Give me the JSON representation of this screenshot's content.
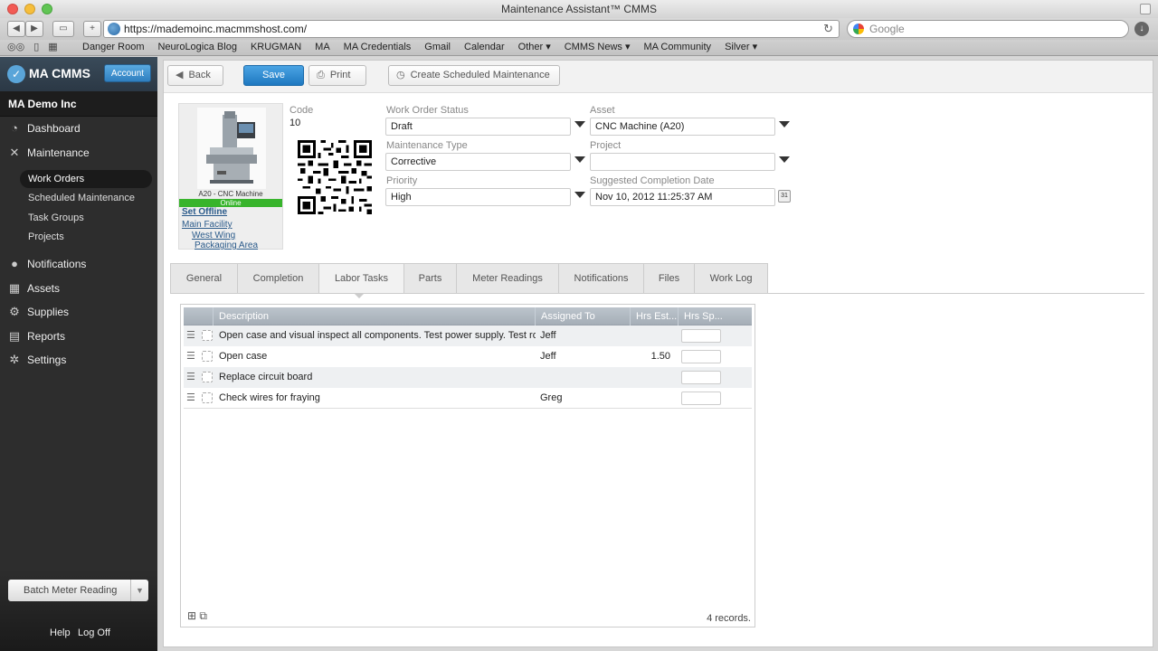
{
  "window": {
    "title": "Maintenance Assistant™ CMMS"
  },
  "browser": {
    "url": "https://mademoinc.macmmshost.com/",
    "search_placeholder": "Google",
    "bookmarks": [
      "Danger Room",
      "NeuroLogica Blog",
      "KRUGMAN",
      "MA",
      "MA Credentials",
      "Gmail",
      "Calendar",
      "Other ▾",
      "CMMS News ▾",
      "MA Community",
      "Silver ▾"
    ]
  },
  "sidebar": {
    "brand": "MA CMMS",
    "account_label": "Account",
    "company": "MA Demo Inc",
    "nav": {
      "dashboard": "Dashboard",
      "maintenance": "Maintenance",
      "work_orders": "Work Orders",
      "scheduled_maintenance": "Scheduled Maintenance",
      "task_groups": "Task Groups",
      "projects": "Projects",
      "notifications": "Notifications",
      "assets": "Assets",
      "supplies": "Supplies",
      "reports": "Reports",
      "settings": "Settings"
    },
    "batch_label": "Batch Meter Reading",
    "help_label": "Help",
    "logoff_label": "Log Off"
  },
  "actions": {
    "back": "Back",
    "save": "Save",
    "print": "Print",
    "create_scheduled": "Create Scheduled Maintenance"
  },
  "asset_card": {
    "caption": "A20 - CNC Machine",
    "status": "Online",
    "set_offline": "Set Offline",
    "location_1": "Main Facility",
    "location_2": "West Wing",
    "location_3": "Packaging Area"
  },
  "form": {
    "code_label": "Code",
    "code_value": "10",
    "status_label": "Work Order Status",
    "status_value": "Draft",
    "type_label": "Maintenance Type",
    "type_value": "Corrective",
    "priority_label": "Priority",
    "priority_value": "High",
    "asset_label": "Asset",
    "asset_value": "CNC Machine (A20)",
    "project_label": "Project",
    "project_value": "",
    "completion_label": "Suggested Completion Date",
    "completion_value": "Nov 10, 2012 11:25:37 AM",
    "calendar_glyph": "31"
  },
  "tabs": [
    "General",
    "Completion",
    "Labor Tasks",
    "Parts",
    "Meter Readings",
    "Notifications",
    "Files",
    "Work Log"
  ],
  "active_tab": "Labor Tasks",
  "tasks": {
    "columns": [
      "Description",
      "Assigned To",
      "Hrs Est...",
      "Hrs Sp..."
    ],
    "rows": [
      {
        "description": "Open case and visual inspect all components. Test power supply. Test rotary c...",
        "assigned": "Jeff",
        "est": ""
      },
      {
        "description": "Open case",
        "assigned": "Jeff",
        "est": "1.50"
      },
      {
        "description": "Replace circuit board",
        "assigned": "",
        "est": ""
      },
      {
        "description": "Check wires for fraying",
        "assigned": "Greg",
        "est": ""
      }
    ],
    "record_count": "4 records."
  }
}
